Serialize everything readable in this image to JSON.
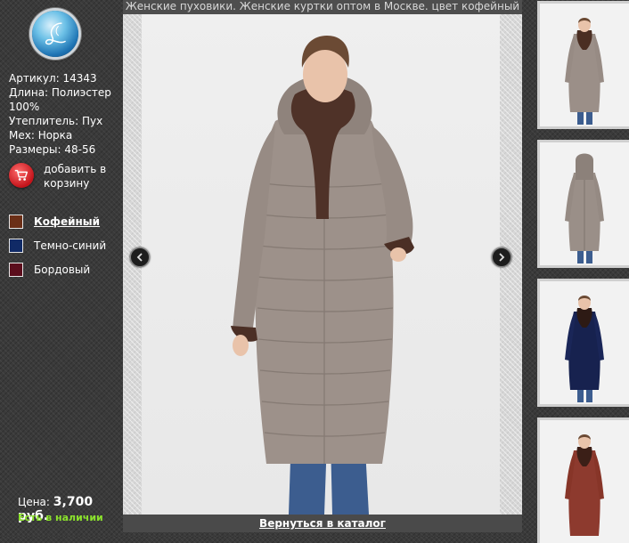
{
  "page_title": "Женские пуховики. Женские куртки оптом в Москве. цвет кофейный",
  "brand": {
    "logo_icon": "script-l-logo-icon"
  },
  "specs": [
    "Артикул: 14343",
    "Длина: Полиэстер 100%",
    "Утеплитель: Пух",
    "Мех: Норка",
    "Размеры: 48-56"
  ],
  "cart": {
    "label": "добавить в корзину",
    "icon": "shopping-cart-icon"
  },
  "colors": [
    {
      "label": "Кофейный",
      "swatch": "#6b2f17",
      "active": true
    },
    {
      "label": "Темно-синий",
      "swatch": "#102a66",
      "active": false
    },
    {
      "label": "Бордовый",
      "swatch": "#5b0d1c",
      "active": false
    }
  ],
  "price": {
    "label": "Цена:",
    "value": "3,700 руб."
  },
  "availability": "Есть в наличии",
  "back_link": "Вернуться в каталог",
  "thumbnails": [
    {
      "color": "#9b8f88",
      "fur": "#4a2e22"
    },
    {
      "color": "#9a8f88",
      "fur": "#4a2e22"
    },
    {
      "color": "#17224f",
      "fur": "#2d1a14"
    },
    {
      "color": "#8d3a2e",
      "fur": "#3b1f17"
    }
  ],
  "theme": {
    "accent_green": "#8be22c",
    "cart_red": "#c4141b"
  }
}
